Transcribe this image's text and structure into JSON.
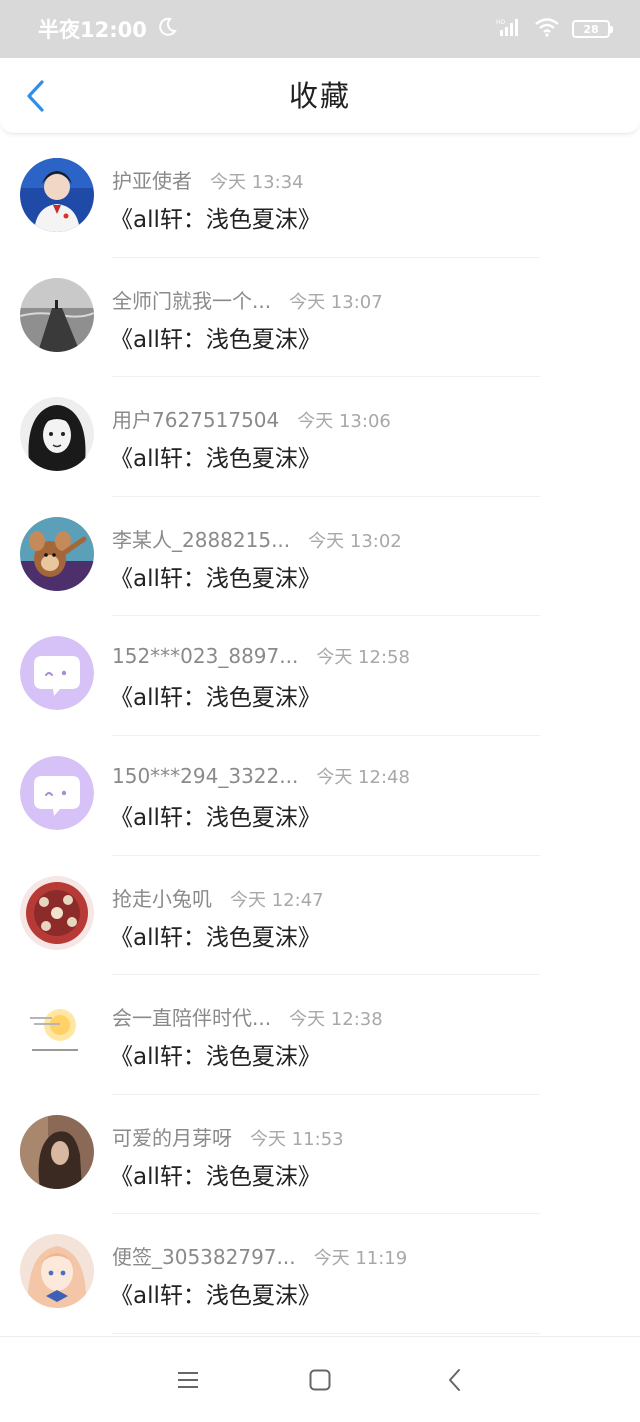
{
  "status_bar": {
    "time": "半夜12:00",
    "battery": "28"
  },
  "header": {
    "title": "收藏"
  },
  "items": [
    {
      "username": "护亚使者",
      "time": "今天 13:34",
      "title": "《all轩：浅色夏沫》",
      "avatar": "photo-boy"
    },
    {
      "username": "全师门就我一个...",
      "time": "今天 13:07",
      "title": "《all轩：浅色夏沫》",
      "avatar": "photo-pier"
    },
    {
      "username": "用户7627517504",
      "time": "今天 13:06",
      "title": "《all轩：浅色夏沫》",
      "avatar": "photo-bw-girl"
    },
    {
      "username": "李某人_2888215...",
      "time": "今天 13:02",
      "title": "《all轩：浅色夏沫》",
      "avatar": "cartoon-jerry"
    },
    {
      "username": "152***023_8897...",
      "time": "今天 12:58",
      "title": "《all轩：浅色夏沫》",
      "avatar": "default-chat"
    },
    {
      "username": "150***294_3322...",
      "time": "今天 12:48",
      "title": "《all轩：浅色夏沫》",
      "avatar": "default-chat"
    },
    {
      "username": "抢走小兔叽",
      "time": "今天 12:47",
      "title": "《all轩：浅色夏沫》",
      "avatar": "illustration-red-pattern"
    },
    {
      "username": "会一直陪伴时代...",
      "time": "今天 12:38",
      "title": "《all轩：浅色夏沫》",
      "avatar": "sun-text"
    },
    {
      "username": "可爱的月芽呀",
      "time": "今天 11:53",
      "title": "《all轩：浅色夏沫》",
      "avatar": "photo-girl-sepia"
    },
    {
      "username": "便签_305382797...",
      "time": "今天 11:19",
      "title": "《all轩：浅色夏沫》",
      "avatar": "anime-girl"
    }
  ],
  "colors": {
    "accent": "#2f8ee8",
    "chat_avatar": "#d6c2f7"
  },
  "icons": {
    "back": "chevron-left-icon",
    "moon": "moon-icon",
    "wifi": "wifi-icon",
    "signal": "signal-icon",
    "menu": "menu-icon",
    "home": "home-icon",
    "back_nav": "back-nav-icon"
  }
}
